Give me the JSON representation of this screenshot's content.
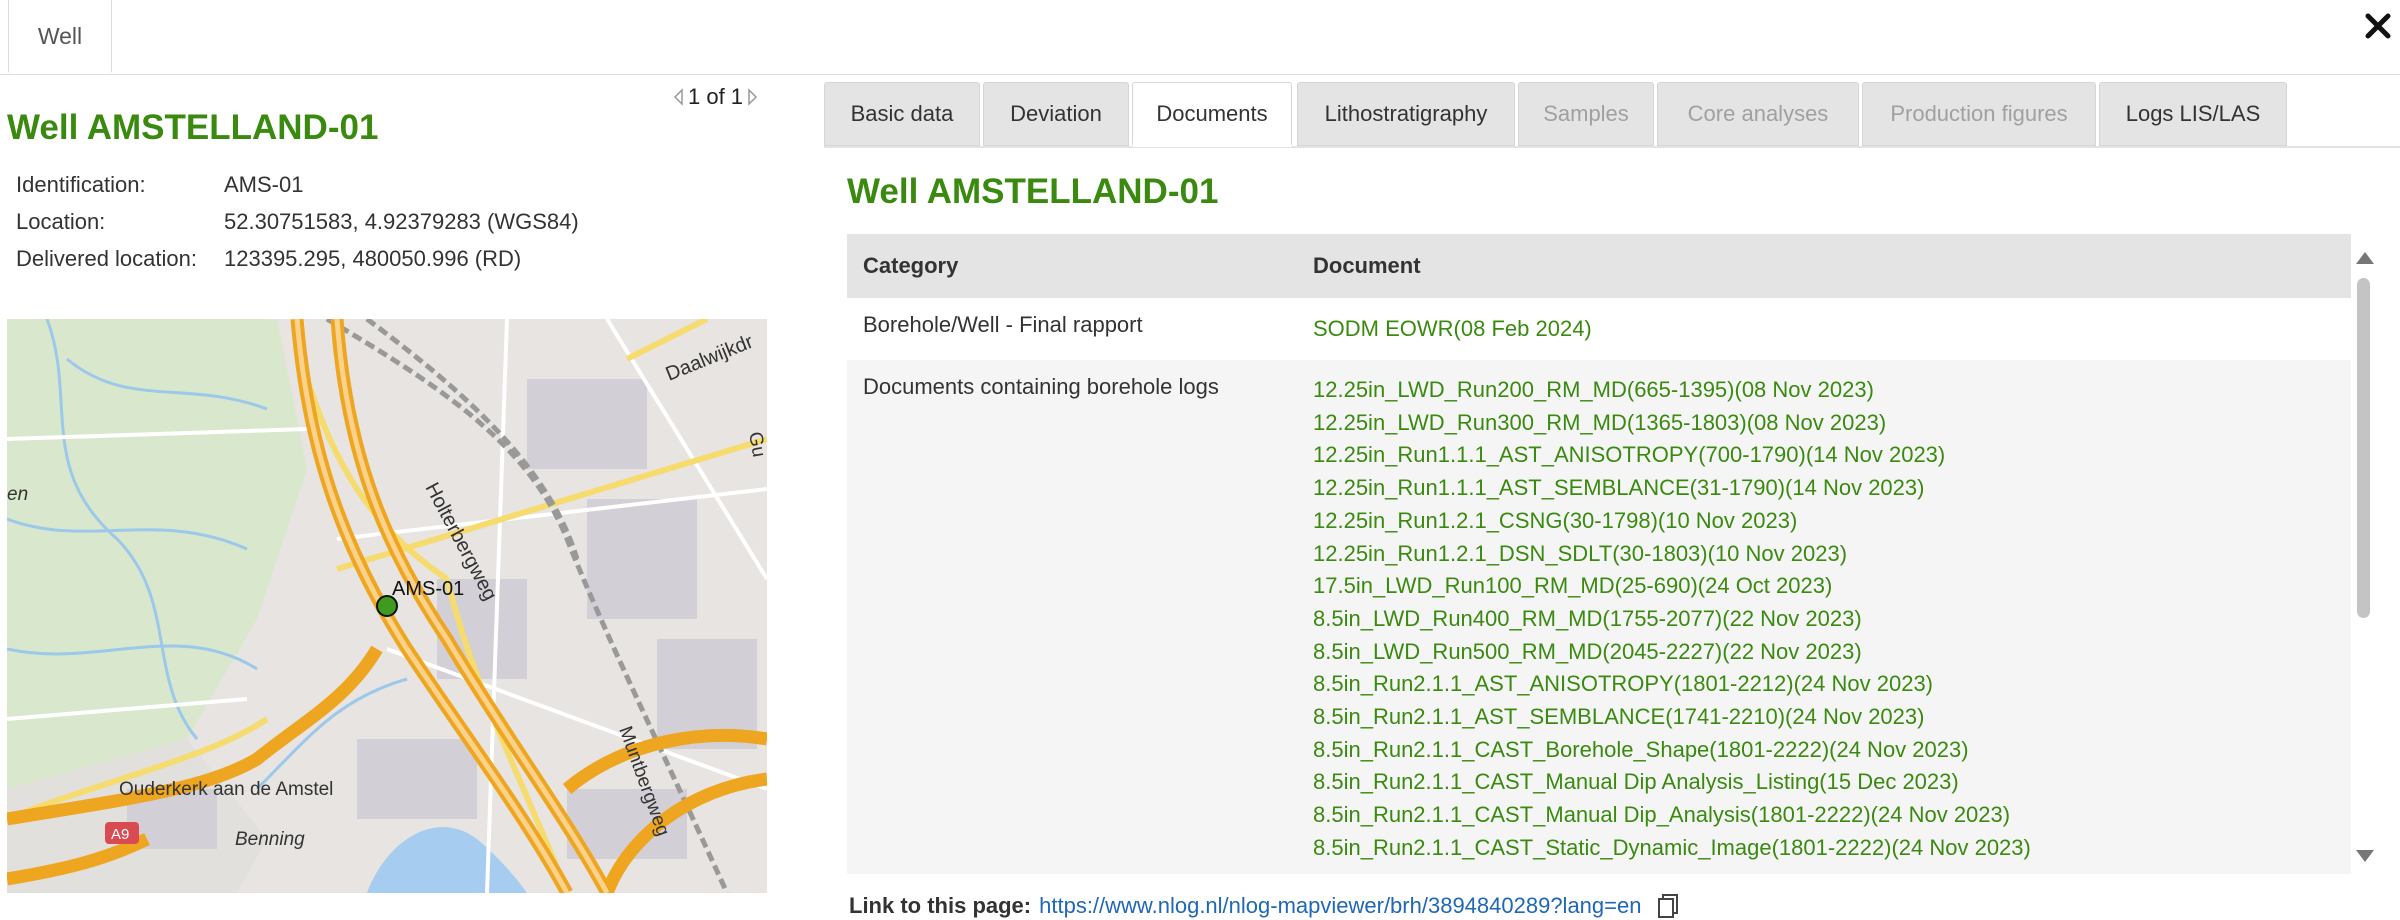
{
  "top": {
    "tab_label": "Well"
  },
  "left": {
    "pager": "1 of 1",
    "title": "Well AMSTELLAND-01",
    "info": [
      {
        "label": "Identification:",
        "value": "AMS-01"
      },
      {
        "label": "Location:",
        "value": "52.30751583, 4.92379283 (WGS84)"
      },
      {
        "label": "Delivered location:",
        "value": "123395.295, 480050.996 (RD)"
      }
    ],
    "map": {
      "marker_label": "AMS-01",
      "labels": [
        "Holterbergweg",
        "Daalwijkdr",
        "Ouderkerk aan de Amstel",
        "Benning",
        "Muntbergweg",
        "en",
        "A9",
        "Gu"
      ]
    }
  },
  "tabs": [
    {
      "label": "Basic data",
      "state": "normal"
    },
    {
      "label": "Deviation",
      "state": "normal"
    },
    {
      "label": "Documents",
      "state": "active"
    },
    {
      "label": "Lithostratigraphy",
      "state": "normal"
    },
    {
      "label": "Samples",
      "state": "disabled"
    },
    {
      "label": "Core analyses",
      "state": "disabled"
    },
    {
      "label": "Production figures",
      "state": "disabled"
    },
    {
      "label": "Logs LIS/LAS",
      "state": "normal"
    }
  ],
  "right": {
    "title": "Well AMSTELLAND-01",
    "table": {
      "headers": [
        "Category",
        "Document"
      ],
      "rows": [
        {
          "category": "Borehole/Well - Final rapport",
          "documents": [
            "SODM EOWR(08 Feb 2024)"
          ]
        },
        {
          "category": "Documents containing borehole logs",
          "documents": [
            "12.25in_LWD_Run200_RM_MD(665-1395)(08 Nov 2023)",
            "12.25in_LWD_Run300_RM_MD(1365-1803)(08 Nov 2023)",
            "12.25in_Run1.1.1_AST_ANISOTROPY(700-1790)(14 Nov 2023)",
            "12.25in_Run1.1.1_AST_SEMBLANCE(31-1790)(14 Nov 2023)",
            "12.25in_Run1.2.1_CSNG(30-1798)(10 Nov 2023)",
            "12.25in_Run1.2.1_DSN_SDLT(30-1803)(10 Nov 2023)",
            "17.5in_LWD_Run100_RM_MD(25-690)(24 Oct 2023)",
            "8.5in_LWD_Run400_RM_MD(1755-2077)(22 Nov 2023)",
            "8.5in_LWD_Run500_RM_MD(2045-2227)(22 Nov 2023)",
            "8.5in_Run2.1.1_AST_ANISOTROPY(1801-2212)(24 Nov 2023)",
            "8.5in_Run2.1.1_AST_SEMBLANCE(1741-2210)(24 Nov 2023)",
            "8.5in_Run2.1.1_CAST_Borehole_Shape(1801-2222)(24 Nov 2023)",
            "8.5in_Run2.1.1_CAST_Manual Dip Analysis_Listing(15 Dec 2023)",
            "8.5in_Run2.1.1_CAST_Manual Dip_Analysis(1801-2222)(24 Nov 2023)",
            "8.5in_Run2.1.1_CAST_Static_Dynamic_Image(1801-2222)(24 Nov 2023)"
          ]
        }
      ]
    },
    "link_label": "Link to this page:",
    "link_url": "https://www.nlog.nl/nlog-mapviewer/brh/3894840289?lang=en"
  },
  "colors": {
    "accent_green": "#3a8a10",
    "link_blue": "#1f67b7",
    "tab_bg": "#e4e4e4"
  }
}
